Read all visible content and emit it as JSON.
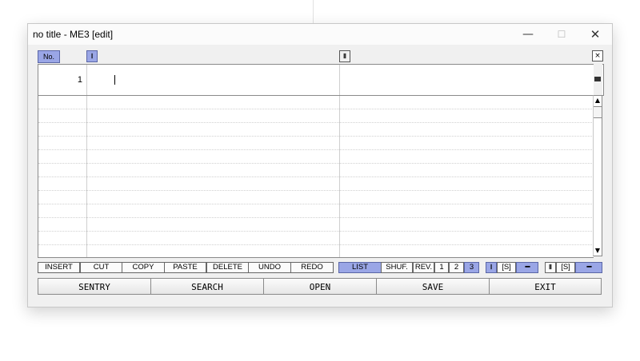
{
  "window": {
    "title": "no title - ME3 [edit]",
    "minimize": "—",
    "maximize": "☐",
    "close": "✕"
  },
  "header": {
    "no_label": "No.",
    "col1_label": "Ⅰ",
    "col2_label": "Ⅱ",
    "close_label": "×"
  },
  "editor": {
    "line_number": "1",
    "col1_value": "",
    "col2_value": ""
  },
  "scrollbar": {
    "up": "▲",
    "down": "▼",
    "side_marker": "■"
  },
  "toolbar": {
    "edit_buttons": [
      "INSERT",
      "CUT",
      "COPY",
      "PASTE",
      "DELETE",
      "UNDO",
      "REDO"
    ],
    "list": "LIST",
    "shuffle": "SHUF.",
    "reverse": "REV.",
    "modes": [
      "1",
      "2",
      "3"
    ],
    "col1": "Ⅰ",
    "col1_s": "[S]",
    "col1_dots": "▪▪▪▪",
    "col2": "Ⅱ",
    "col2_s": "[S]",
    "col2_dots": "▪▪▪▪"
  },
  "actions": {
    "sentry": "SENTRY",
    "search": "SEARCH",
    "open": "OPEN",
    "save": "SAVE",
    "exit": "EXIT"
  },
  "colors": {
    "selected": "#9aa6e6",
    "window_bg": "#f0f0f0"
  }
}
